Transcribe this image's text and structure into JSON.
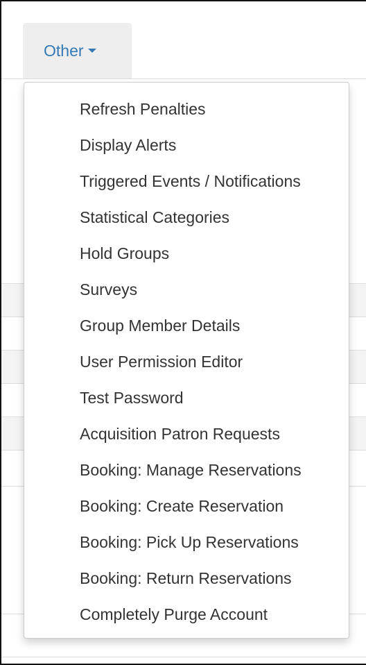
{
  "nav": {
    "dropdown_label": "Other",
    "caret_icon": "caret-down-icon",
    "accent_color": "#337ab7"
  },
  "menu": {
    "items": [
      {
        "label": "Refresh Penalties"
      },
      {
        "label": "Display Alerts"
      },
      {
        "label": "Triggered Events / Notifications"
      },
      {
        "label": "Statistical Categories"
      },
      {
        "label": "Hold Groups"
      },
      {
        "label": "Surveys"
      },
      {
        "label": "Group Member Details"
      },
      {
        "label": "User Permission Editor"
      },
      {
        "label": "Test Password"
      },
      {
        "label": "Acquisition Patron Requests"
      },
      {
        "label": "Booking: Manage Reservations"
      },
      {
        "label": "Booking: Create Reservation"
      },
      {
        "label": "Booking: Pick Up Reservations"
      },
      {
        "label": "Booking: Return Reservations"
      },
      {
        "label": "Completely Purge Account"
      }
    ]
  }
}
